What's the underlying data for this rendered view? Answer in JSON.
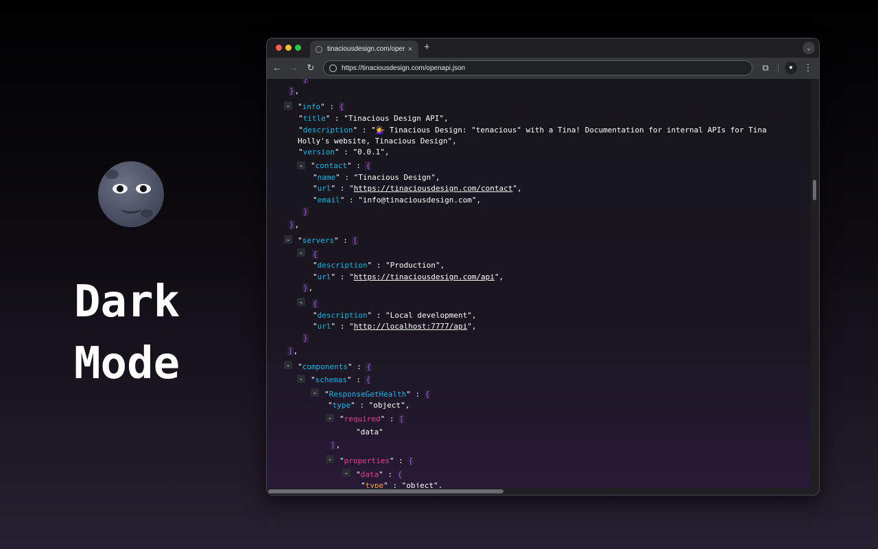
{
  "promo": {
    "emoji_icon": "full-moon-face-emoji",
    "title_line1": "Dark",
    "title_line2": "Mode"
  },
  "browser": {
    "tab": {
      "title": "tinaciousdesign.com/openapi",
      "close_label": "×"
    },
    "new_tab_label": "+",
    "tab_menu_label": "⌄",
    "toolbar": {
      "back_label": "←",
      "forward_label": "→",
      "reload_label": "↻",
      "url": "https://tinaciousdesign.com/openapi.json",
      "extensions_label": "⧉",
      "profile_label": "●",
      "menu_label": "⋮"
    }
  },
  "json_view": {
    "colors": {
      "key": "#19b5e9",
      "key_alt": "#ec3e8f",
      "key_type": "#ff9f43",
      "bracket": "#a05be6"
    },
    "info": {
      "key": "info",
      "title_key": "title",
      "title_value": "Tinacious Design API",
      "description_key": "description",
      "description_line1": "💁‍♀️ Tinacious Design: \"tenacious\" with a Tina! Documentation for internal APIs for Tina",
      "description_line2": "Holly's website, Tinacious Design\",",
      "version_key": "version",
      "version_value": "0.0.1",
      "contact_key": "contact",
      "contact_name_key": "name",
      "contact_name_value": "Tinacious Design",
      "contact_url_key": "url",
      "contact_url_value": "https://tinaciousdesign.com/contact",
      "contact_email_key": "email",
      "contact_email_value": "info@tinaciousdesign.com"
    },
    "servers": {
      "key": "servers",
      "items": [
        {
          "description_key": "description",
          "description_value": "Production",
          "url_key": "url",
          "url_value": "https://tinaciousdesign.com/api"
        },
        {
          "description_key": "description",
          "description_value": "Local development",
          "url_key": "url",
          "url_value": "http://localhost:7777/api"
        }
      ]
    },
    "components": {
      "key": "components",
      "schemas_key": "schemas",
      "response_key": "ResponseGetHealth",
      "type_key": "type",
      "type_value": "object",
      "required_key": "required",
      "required_item": "data",
      "properties_key": "properties",
      "data_key": "data",
      "data_type_key": "type",
      "data_type_value": "object"
    }
  }
}
